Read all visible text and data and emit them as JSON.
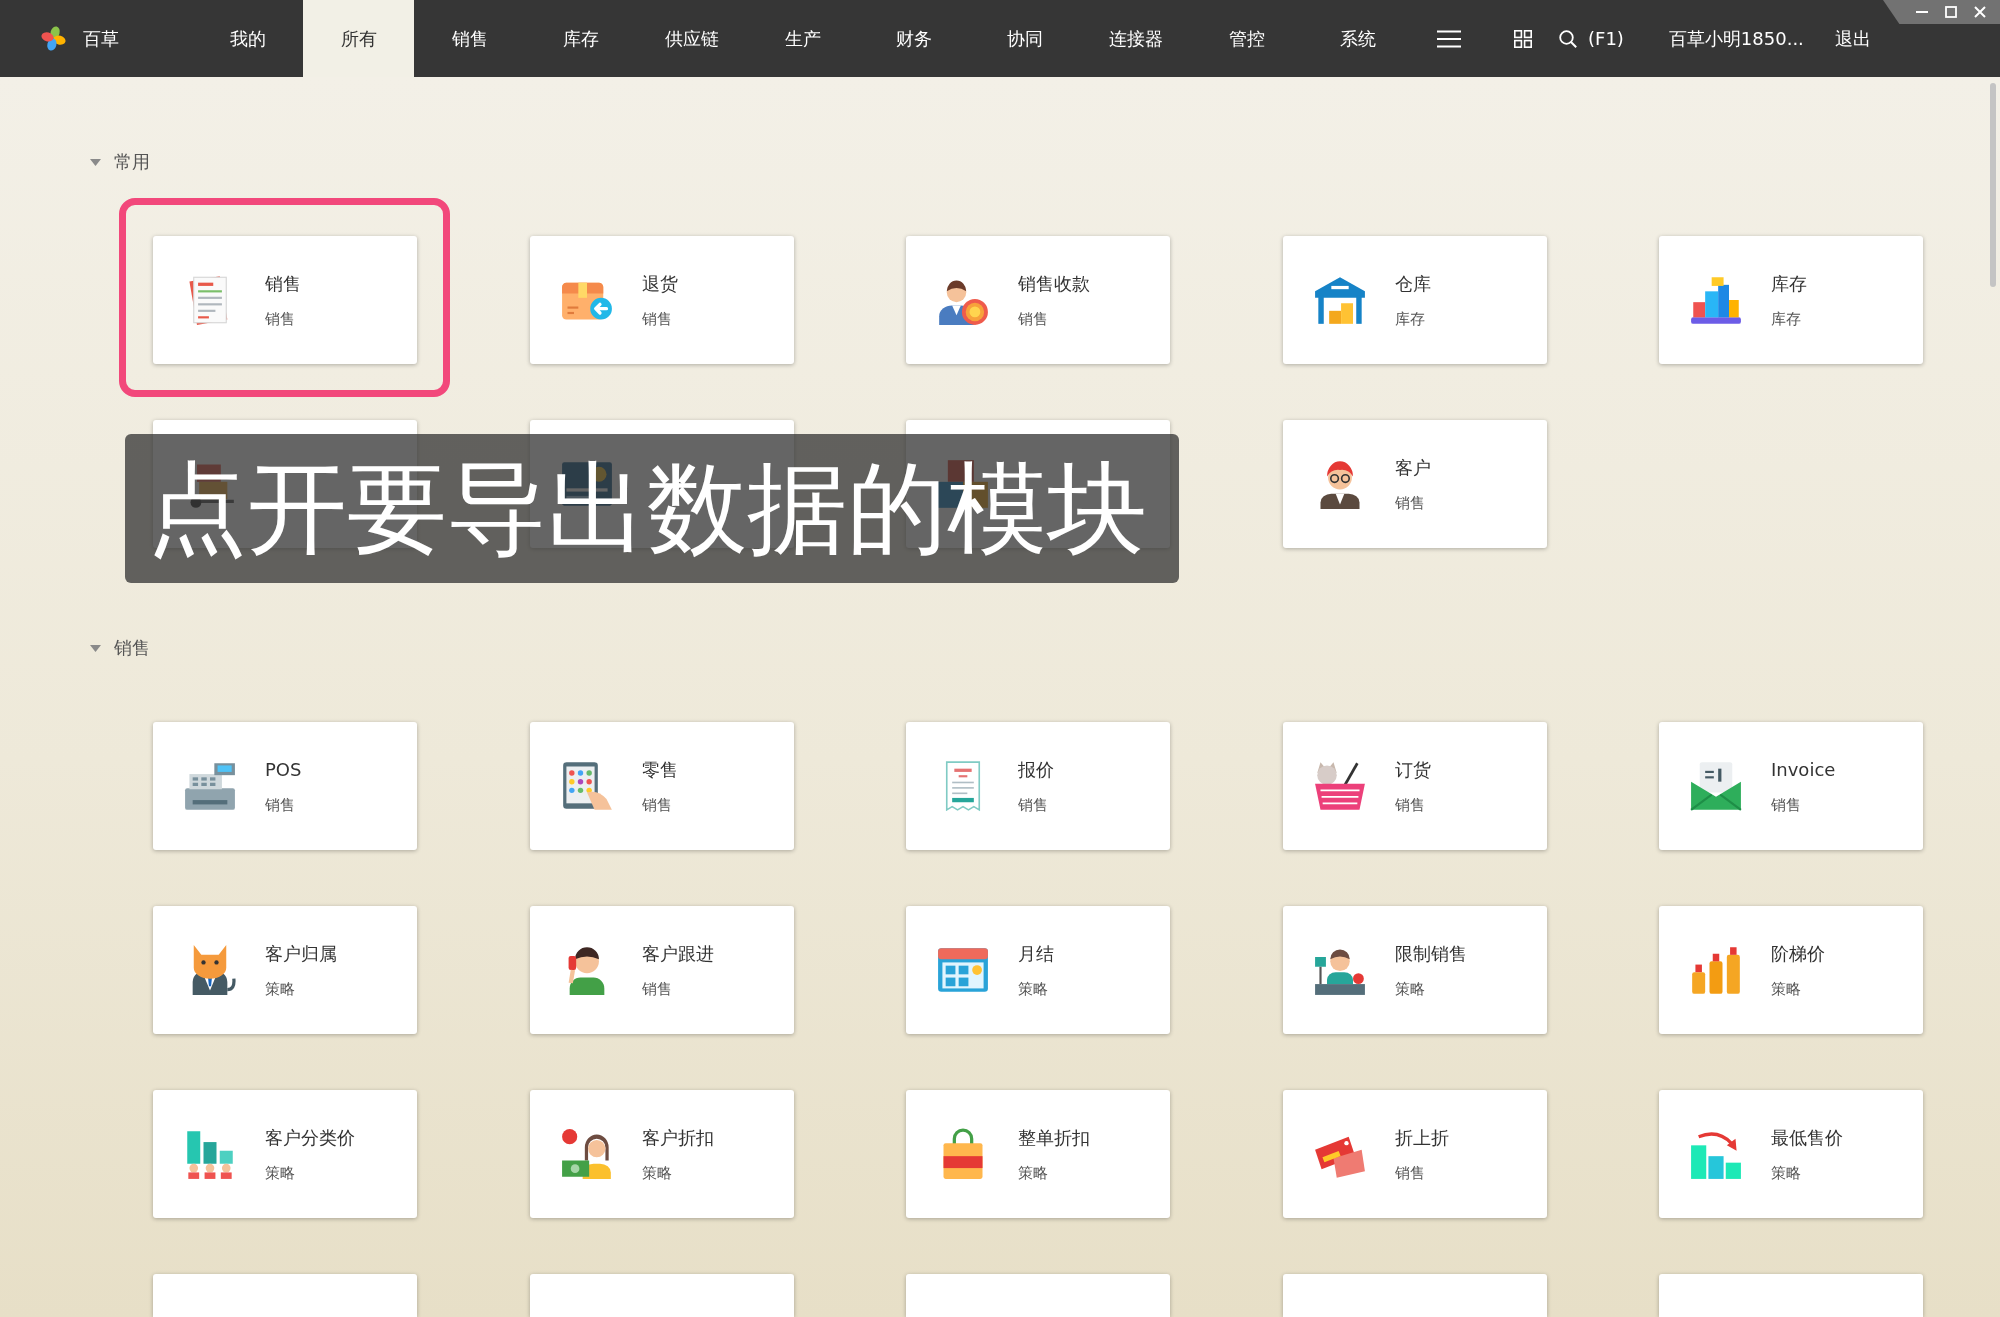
{
  "app": {
    "name": "百草"
  },
  "nav": {
    "tabs": [
      {
        "label": "我的",
        "selected": false
      },
      {
        "label": "所有",
        "selected": true
      },
      {
        "label": "销售",
        "selected": false
      },
      {
        "label": "库存",
        "selected": false
      },
      {
        "label": "供应链",
        "selected": false
      },
      {
        "label": "生产",
        "selected": false
      },
      {
        "label": "财务",
        "selected": false
      },
      {
        "label": "协同",
        "selected": false
      },
      {
        "label": "连接器",
        "selected": false
      },
      {
        "label": "管控",
        "selected": false
      },
      {
        "label": "系统",
        "selected": false
      }
    ],
    "search_shortcut": "(F1)",
    "user": "百草小明1850...",
    "logout": "退出"
  },
  "sections": [
    {
      "title": "常用",
      "expanded": true,
      "cards": [
        {
          "kind": "module",
          "title": "销售",
          "category": "销售",
          "highlighted": true
        },
        {
          "kind": "module",
          "title": "退货",
          "category": "销售",
          "highlighted": false
        },
        {
          "kind": "module",
          "title": "销售收款",
          "category": "销售",
          "highlighted": false
        },
        {
          "kind": "module",
          "title": "仓库",
          "category": "库存",
          "highlighted": false
        },
        {
          "kind": "module",
          "title": "库存",
          "category": "库存",
          "highlighted": false
        },
        {
          "kind": "module",
          "highlighted": false
        },
        {
          "kind": "module",
          "highlighted": false
        },
        {
          "kind": "module",
          "highlighted": false
        },
        {
          "kind": "module",
          "title": "客户",
          "category": "销售",
          "highlighted": false
        }
      ]
    },
    {
      "title": "销售",
      "expanded": true,
      "cards": [
        {
          "kind": "module",
          "title": "POS",
          "category": "销售",
          "highlighted": false
        },
        {
          "kind": "module",
          "title": "零售",
          "category": "销售",
          "highlighted": false
        },
        {
          "kind": "module",
          "title": "报价",
          "category": "销售",
          "highlighted": false
        },
        {
          "kind": "module",
          "title": "订货",
          "category": "销售",
          "highlighted": false
        },
        {
          "kind": "module",
          "title": "Invoice",
          "category": "销售",
          "highlighted": false
        },
        {
          "kind": "module",
          "title": "客户归属",
          "category": "策略",
          "highlighted": false
        },
        {
          "kind": "module",
          "title": "客户跟进",
          "category": "销售",
          "highlighted": false
        },
        {
          "kind": "module",
          "title": "月结",
          "category": "策略",
          "highlighted": false
        },
        {
          "kind": "module",
          "title": "限制销售",
          "category": "策略",
          "highlighted": false
        },
        {
          "kind": "module",
          "title": "阶梯价",
          "category": "策略",
          "highlighted": false
        },
        {
          "kind": "module",
          "title": "客户分类价",
          "category": "策略",
          "highlighted": false
        },
        {
          "kind": "module",
          "title": "客户折扣",
          "category": "策略",
          "highlighted": false
        },
        {
          "kind": "module",
          "title": "整单折扣",
          "category": "策略",
          "highlighted": false
        },
        {
          "kind": "module",
          "title": "折上折",
          "category": "销售",
          "highlighted": false
        },
        {
          "kind": "module",
          "title": "最低售价",
          "category": "策略",
          "highlighted": false
        },
        {
          "kind": "cut",
          "highlighted": false
        },
        {
          "kind": "cut",
          "highlighted": false
        },
        {
          "kind": "cut",
          "highlighted": false
        },
        {
          "kind": "cut",
          "highlighted": false
        },
        {
          "kind": "cut",
          "highlighted": false
        }
      ]
    }
  ],
  "caption": "点开要导出数据的模块"
}
